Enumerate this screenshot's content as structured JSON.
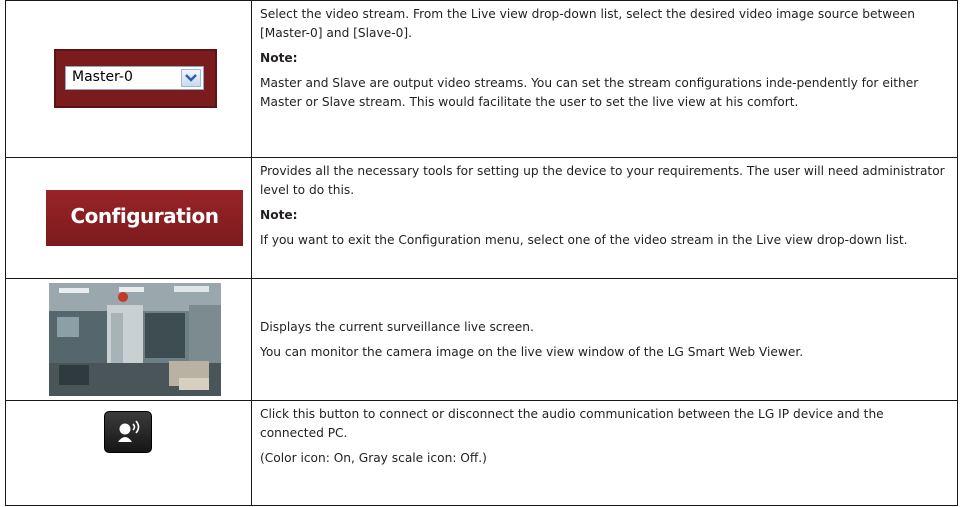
{
  "rows": [
    {
      "widget": {
        "type": "dropdown",
        "value": "Master-0",
        "icon": "chevron-down-icon",
        "frame_color": "#7a1c1e"
      },
      "paragraphs": [
        "Select the video stream. From the Live view drop-down list, select the desired video image source between [Master-0] and [Slave-0].",
        "Note:",
        "Master and Slave are output video streams. You can set the stream configurations inde-pendently for either Master or Slave stream. This would facilitate the user to set the live view at his comfort."
      ]
    },
    {
      "widget": {
        "type": "button",
        "label": "Configuration",
        "color": "#8b1f22"
      },
      "paragraphs": [
        "Provides all the necessary tools for setting up the device to your requirements. The user will need administrator level to do this.",
        "Note:",
        "If you want to exit the Configuration menu, select one of the video stream in the Live view drop-down list."
      ]
    },
    {
      "widget": {
        "type": "image",
        "icon": "live-view-thumbnail"
      },
      "paragraphs": [
        "Displays the current surveillance live screen.",
        "You can monitor the camera image on the live view window of the LG Smart Web Viewer."
      ]
    },
    {
      "widget": {
        "type": "button",
        "icon": "audio-speaker-icon"
      },
      "paragraphs": [
        "Click this button to connect or disconnect the audio communication between the LG IP device and the connected PC.",
        "(Color icon: On, Gray scale icon: Off.)"
      ]
    }
  ]
}
